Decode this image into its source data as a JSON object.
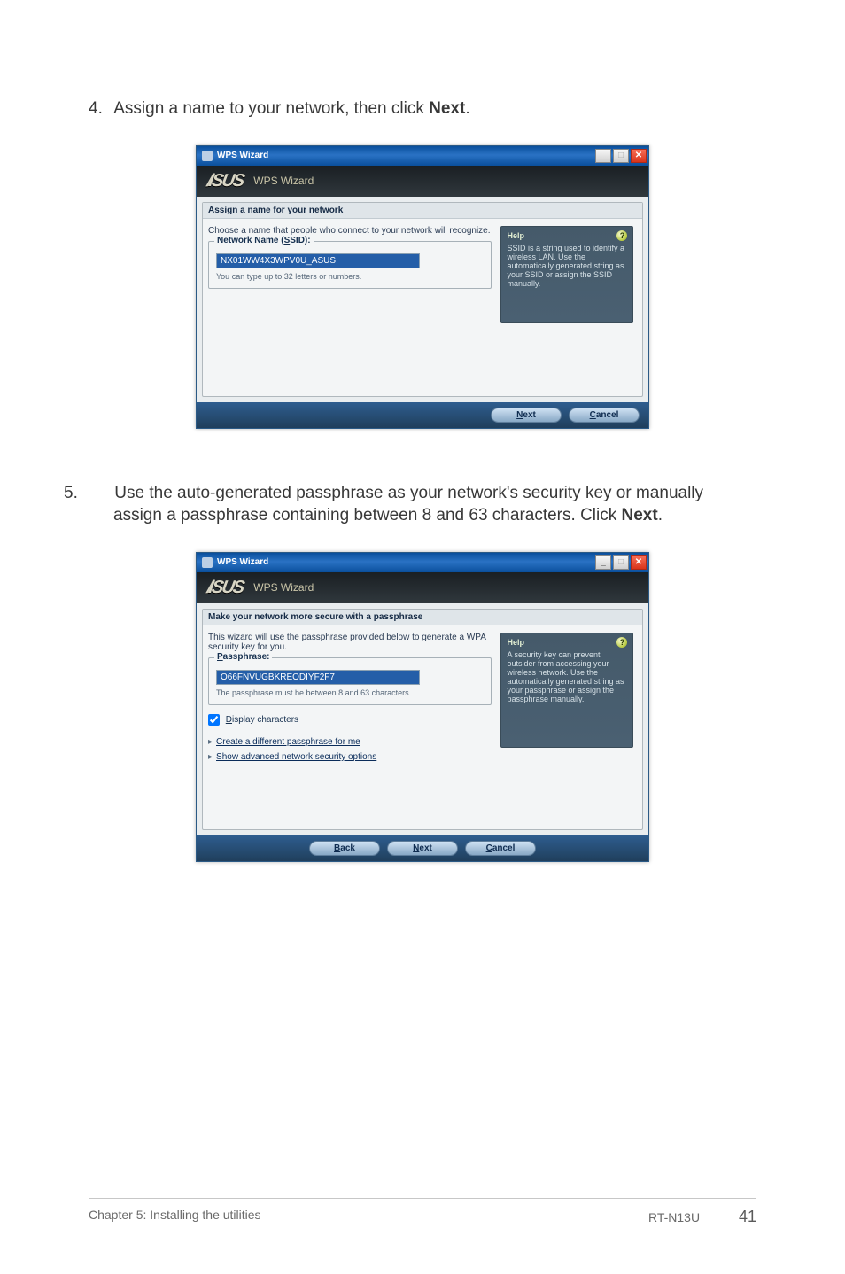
{
  "step4": {
    "number": "4.",
    "text_before": "Assign a name to your network, then click ",
    "bold": "Next",
    "text_after": "."
  },
  "step5": {
    "number": "5.",
    "text_before": "Use the auto-generated passphrase as your network's security key or manually assign a passphrase containing between 8 and 63 characters. Click ",
    "bold": "Next",
    "text_after": "."
  },
  "dialog1": {
    "titlebar": "WPS Wizard",
    "brand": "ISUS",
    "brand_sub": "WPS Wizard",
    "panel_title": "Assign a name for your network",
    "desc": "Choose a name that people who connect to your network will recognize.",
    "fieldset_legend": "Network Name (SSID):",
    "legend_ul_char": "S",
    "input_value": "NX01WW4X3WPV0U_ASUS",
    "hint": "You can type up to 32 letters or numbers.",
    "help_title": "Help",
    "help_text": "SSID is a string used to identify a wireless LAN. Use the automatically generated string as your SSID or assign the SSID manually.",
    "btn_next": "Next",
    "btn_cancel": "Cancel"
  },
  "dialog2": {
    "titlebar": "WPS Wizard",
    "brand": "ISUS",
    "brand_sub": "WPS Wizard",
    "panel_title": "Make your network more secure with a passphrase",
    "desc": "This wizard will use the passphrase provided below to generate a WPA security key for you.",
    "fieldset_legend": "Passphrase:",
    "legend_ul_char": "P",
    "input_value": "O66FNVUGBKREODIYF2F7",
    "hint": "The passphrase must be between 8 and 63 characters.",
    "checkbox_label": "Display characters",
    "checkbox_ul": "D",
    "link1": "Create a different passphrase for me",
    "link2": "Show advanced network security options",
    "help_title": "Help",
    "help_text": "A security key can prevent outsider from accessing your wireless network. Use the automatically generated string as your passphrase or assign the passphrase manually.",
    "btn_back": "Back",
    "btn_next": "Next",
    "btn_cancel": "Cancel"
  },
  "footer": {
    "left": "Chapter 5: Installing the utilities",
    "right": "RT-N13U",
    "page": "41"
  }
}
